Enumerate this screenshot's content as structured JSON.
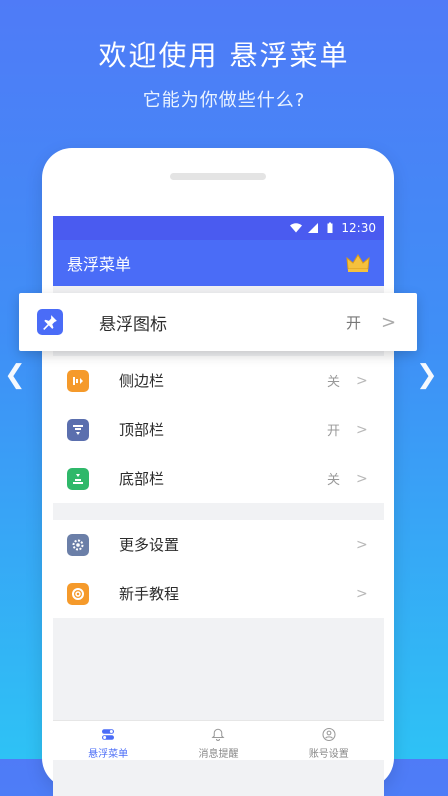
{
  "hero": {
    "title": "欢迎使用 悬浮菜单",
    "subtitle": "它能为你做些什么?"
  },
  "statusbar": {
    "time": "12:30"
  },
  "appbar": {
    "title": "悬浮菜单"
  },
  "highlight": {
    "label": "悬浮图标",
    "state": "开",
    "icon": "pin-icon"
  },
  "section1": [
    {
      "label": "侧边栏",
      "state": "关",
      "icon": "sidebar-icon",
      "color": "#f59a2b"
    },
    {
      "label": "顶部栏",
      "state": "开",
      "icon": "topbar-icon",
      "color": "#5b6fae"
    },
    {
      "label": "底部栏",
      "state": "关",
      "icon": "bottombar-icon",
      "color": "#2fb86a"
    }
  ],
  "section2": [
    {
      "label": "更多设置",
      "state": "",
      "icon": "gear-icon",
      "color": "#6b7fa8"
    },
    {
      "label": "新手教程",
      "state": "",
      "icon": "lifebuoy-icon",
      "color": "#f59a2b"
    }
  ],
  "bottom_nav": [
    {
      "label": "悬浮菜单",
      "icon": "toggle-icon",
      "active": true
    },
    {
      "label": "消息提醒",
      "icon": "bell-icon",
      "active": false
    },
    {
      "label": "账号设置",
      "icon": "user-icon",
      "active": false
    }
  ]
}
